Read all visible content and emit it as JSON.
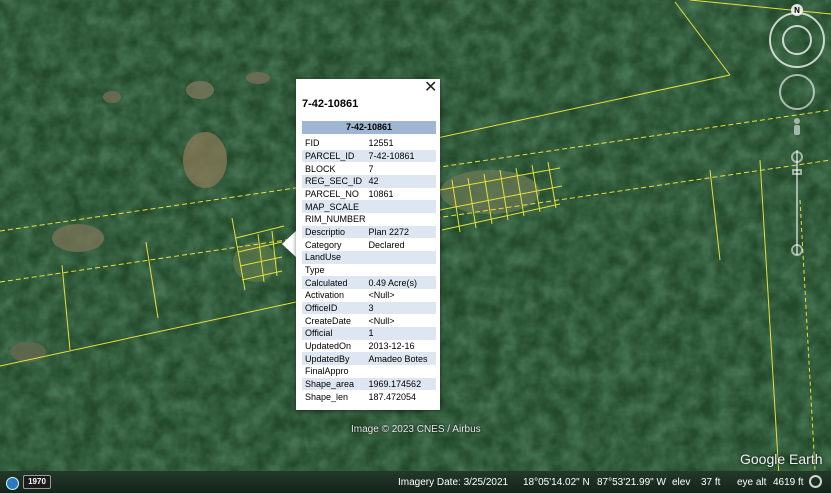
{
  "popup": {
    "title": "7-42-10861",
    "header": "7-42-10861",
    "close_label": "✕",
    "rows": [
      {
        "key": "FID",
        "value": "12551"
      },
      {
        "key": "PARCEL_ID",
        "value": "7-42-10861"
      },
      {
        "key": "BLOCK",
        "value": "7"
      },
      {
        "key": "REG_SEC_ID",
        "value": "42"
      },
      {
        "key": "PARCEL_NO",
        "value": "10861"
      },
      {
        "key": "MAP_SCALE",
        "value": ""
      },
      {
        "key": "RIM_NUMBER",
        "value": ""
      },
      {
        "key": "Descriptio",
        "value": "Plan 2272"
      },
      {
        "key": "Category",
        "value": "Declared"
      },
      {
        "key": "LandUse",
        "value": ""
      },
      {
        "key": "Type",
        "value": ""
      },
      {
        "key": "Calculated",
        "value": "0.49 Acre(s)"
      },
      {
        "key": "Activation",
        "value": "<Null>"
      },
      {
        "key": "OfficeID",
        "value": "3"
      },
      {
        "key": "CreateDate",
        "value": "<Null>"
      },
      {
        "key": "Official",
        "value": "1"
      },
      {
        "key": "UpdatedOn",
        "value": "2013-12-16"
      },
      {
        "key": "UpdatedBy",
        "value": "Amadeo Botes"
      },
      {
        "key": "FinalAppro",
        "value": ""
      },
      {
        "key": "Shape_area",
        "value": "1969.174562"
      },
      {
        "key": "Shape_len",
        "value": "187.472054"
      }
    ]
  },
  "map": {
    "copyright": "Image © 2023 CNES / Airbus",
    "compass_label": "N",
    "brand": "Google Earth"
  },
  "status": {
    "year": "1970",
    "imagery_date": "Imagery Date: 3/25/2021",
    "lat": "18°05'14.02\" N",
    "lon": "87°53'21.99\" W",
    "elev_label": "elev",
    "elev_value": "37 ft",
    "eye_alt_label": "eye alt",
    "eye_alt_value": "4619 ft"
  },
  "colors": {
    "parcel_line": "#e6e03a",
    "header_bg": "#9fb6d3",
    "row_alt": "#dde6f1"
  }
}
